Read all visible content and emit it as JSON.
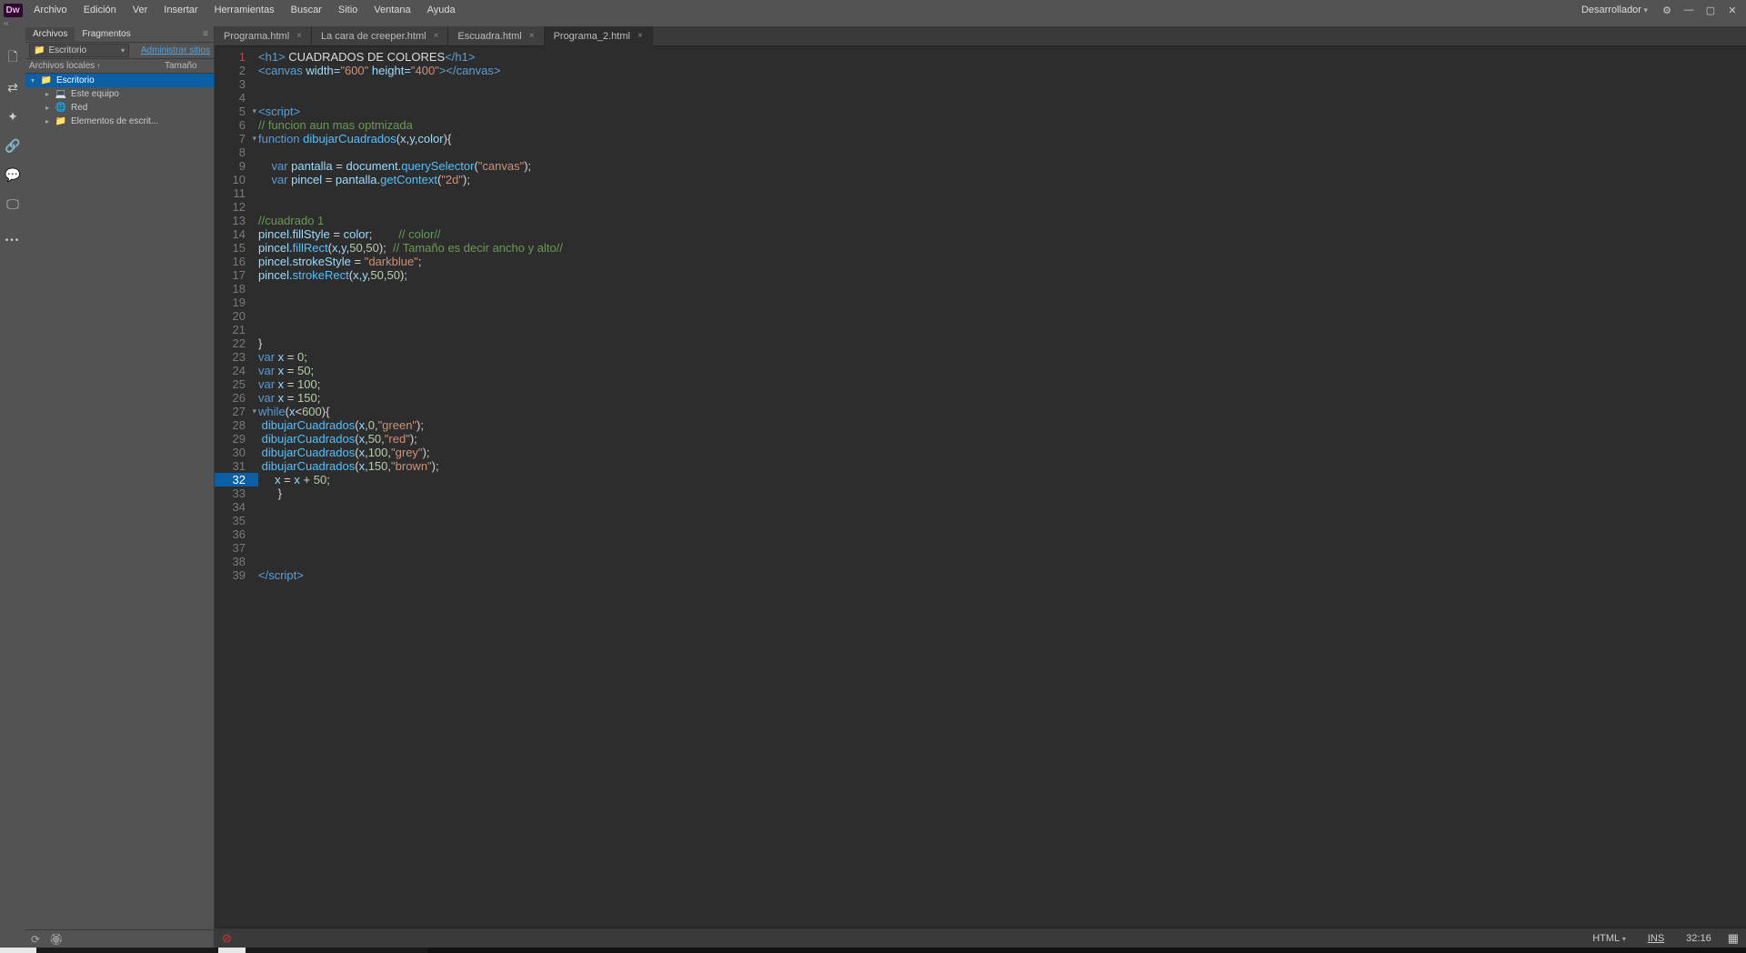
{
  "menubar": [
    "Archivo",
    "Edición",
    "Ver",
    "Insertar",
    "Herramientas",
    "Buscar",
    "Sitio",
    "Ventana",
    "Ayuda"
  ],
  "right_label": "Desarrollador",
  "panel": {
    "tabs": [
      "Archivos",
      "Fragmentos"
    ],
    "site": "Escritorio",
    "manage": "Administrar sitios",
    "col1": "Archivos locales",
    "col2": "Tamaño",
    "tree": [
      {
        "depth": 0,
        "exp": "▾",
        "icon": "📁",
        "label": "Escritorio",
        "selected": true,
        "color": "#4aa3df"
      },
      {
        "depth": 1,
        "exp": "▸",
        "icon": "💻",
        "label": "Este equipo",
        "color": "#5aa0d6"
      },
      {
        "depth": 1,
        "exp": "▸",
        "icon": "🌐",
        "label": "Red",
        "color": "#5aa0d6"
      },
      {
        "depth": 1,
        "exp": "▸",
        "icon": "📁",
        "label": "Elementos de escrit...",
        "color": "#d8a13a"
      }
    ]
  },
  "file_tabs": [
    {
      "label": "Programa.html",
      "active": false
    },
    {
      "label": "La cara de creeper.html",
      "active": false
    },
    {
      "label": "Escuadra.html",
      "active": false
    },
    {
      "label": "Programa_2.html",
      "active": true
    }
  ],
  "current_line": 32,
  "fold_lines": [
    5,
    7,
    27
  ],
  "code_lines": [
    [
      [
        "tag",
        "<h1>"
      ],
      [
        "txt",
        " CUADRADOS DE COLORES"
      ],
      [
        "tag",
        "</h1>"
      ]
    ],
    [
      [
        "tag",
        "<canvas "
      ],
      [
        "attr",
        "width="
      ],
      [
        "str",
        "\"600\""
      ],
      [
        "txt",
        " "
      ],
      [
        "attr",
        "height="
      ],
      [
        "str",
        "\"400\""
      ],
      [
        "tag",
        "></canvas>"
      ]
    ],
    [],
    [],
    [
      [
        "tag",
        "<script>"
      ]
    ],
    [
      [
        "cmt",
        "// funcion aun mas optmizada"
      ]
    ],
    [
      [
        "kw",
        "function "
      ],
      [
        "fn",
        "dibujarCuadrados"
      ],
      [
        "op",
        "("
      ],
      [
        "var",
        "x"
      ],
      [
        "op",
        ","
      ],
      [
        "var",
        "y"
      ],
      [
        "op",
        ","
      ],
      [
        "var",
        "color"
      ],
      [
        "op",
        ")"
      ],
      [
        "op",
        "{"
      ]
    ],
    [],
    [
      [
        "txt",
        "    "
      ],
      [
        "kw",
        "var "
      ],
      [
        "var",
        "pantalla"
      ],
      [
        "op",
        " = "
      ],
      [
        "var",
        "document"
      ],
      [
        "op",
        "."
      ],
      [
        "fn",
        "querySelector"
      ],
      [
        "op",
        "("
      ],
      [
        "str",
        "\"canvas\""
      ],
      [
        "op",
        ");"
      ]
    ],
    [
      [
        "txt",
        "    "
      ],
      [
        "kw",
        "var "
      ],
      [
        "var",
        "pincel"
      ],
      [
        "op",
        " = "
      ],
      [
        "var",
        "pantalla"
      ],
      [
        "op",
        "."
      ],
      [
        "fn",
        "getContext"
      ],
      [
        "op",
        "("
      ],
      [
        "str",
        "\"2d\""
      ],
      [
        "op",
        ");"
      ]
    ],
    [],
    [],
    [
      [
        "cmt",
        "//cuadrado 1"
      ]
    ],
    [
      [
        "var",
        "pincel"
      ],
      [
        "op",
        "."
      ],
      [
        "var",
        "fillStyle"
      ],
      [
        "op",
        " = "
      ],
      [
        "var",
        "color"
      ],
      [
        "op",
        ";        "
      ],
      [
        "cmt",
        "// color//"
      ]
    ],
    [
      [
        "var",
        "pincel"
      ],
      [
        "op",
        "."
      ],
      [
        "fn",
        "fillRect"
      ],
      [
        "op",
        "("
      ],
      [
        "var",
        "x"
      ],
      [
        "op",
        ","
      ],
      [
        "var",
        "y"
      ],
      [
        "op",
        ","
      ],
      [
        "num",
        "50"
      ],
      [
        "op",
        ","
      ],
      [
        "num",
        "50"
      ],
      [
        "op",
        ");  "
      ],
      [
        "cmt",
        "// Tamaño es decir ancho y alto//"
      ]
    ],
    [
      [
        "var",
        "pincel"
      ],
      [
        "op",
        "."
      ],
      [
        "var",
        "strokeStyle"
      ],
      [
        "op",
        " = "
      ],
      [
        "str",
        "\"darkblue\""
      ],
      [
        "op",
        ";"
      ]
    ],
    [
      [
        "var",
        "pincel"
      ],
      [
        "op",
        "."
      ],
      [
        "fn",
        "strokeRect"
      ],
      [
        "op",
        "("
      ],
      [
        "var",
        "x"
      ],
      [
        "op",
        ","
      ],
      [
        "var",
        "y"
      ],
      [
        "op",
        ","
      ],
      [
        "num",
        "50"
      ],
      [
        "op",
        ","
      ],
      [
        "num",
        "50"
      ],
      [
        "op",
        ");"
      ]
    ],
    [],
    [],
    [],
    [],
    [
      [
        "op",
        "}"
      ]
    ],
    [
      [
        "kw",
        "var "
      ],
      [
        "var",
        "x"
      ],
      [
        "op",
        " = "
      ],
      [
        "num",
        "0"
      ],
      [
        "op",
        ";"
      ]
    ],
    [
      [
        "kw",
        "var "
      ],
      [
        "var",
        "x"
      ],
      [
        "op",
        " = "
      ],
      [
        "num",
        "50"
      ],
      [
        "op",
        ";"
      ]
    ],
    [
      [
        "kw",
        "var "
      ],
      [
        "var",
        "x"
      ],
      [
        "op",
        " = "
      ],
      [
        "num",
        "100"
      ],
      [
        "op",
        ";"
      ]
    ],
    [
      [
        "kw",
        "var "
      ],
      [
        "var",
        "x"
      ],
      [
        "op",
        " = "
      ],
      [
        "num",
        "150"
      ],
      [
        "op",
        ";"
      ]
    ],
    [
      [
        "kw",
        "while"
      ],
      [
        "op",
        "("
      ],
      [
        "var",
        "x"
      ],
      [
        "op",
        "<"
      ],
      [
        "num",
        "600"
      ],
      [
        "op",
        ")"
      ],
      [
        "op",
        "{"
      ]
    ],
    [
      [
        "fn",
        " dibujarCuadrados"
      ],
      [
        "op",
        "("
      ],
      [
        "var",
        "x"
      ],
      [
        "op",
        ","
      ],
      [
        "num",
        "0"
      ],
      [
        "op",
        ","
      ],
      [
        "str",
        "\"green\""
      ],
      [
        "op",
        ");"
      ]
    ],
    [
      [
        "fn",
        " dibujarCuadrados"
      ],
      [
        "op",
        "("
      ],
      [
        "var",
        "x"
      ],
      [
        "op",
        ","
      ],
      [
        "num",
        "50"
      ],
      [
        "op",
        ","
      ],
      [
        "str",
        "\"red\""
      ],
      [
        "op",
        ");"
      ]
    ],
    [
      [
        "fn",
        " dibujarCuadrados"
      ],
      [
        "op",
        "("
      ],
      [
        "var",
        "x"
      ],
      [
        "op",
        ","
      ],
      [
        "num",
        "100"
      ],
      [
        "op",
        ","
      ],
      [
        "str",
        "\"grey\""
      ],
      [
        "op",
        ");"
      ]
    ],
    [
      [
        "fn",
        " dibujarCuadrados"
      ],
      [
        "op",
        "("
      ],
      [
        "var",
        "x"
      ],
      [
        "op",
        ","
      ],
      [
        "num",
        "150"
      ],
      [
        "op",
        ","
      ],
      [
        "str",
        "\"brown\""
      ],
      [
        "op",
        ");"
      ]
    ],
    [
      [
        "txt",
        "     "
      ],
      [
        "var",
        "x"
      ],
      [
        "op",
        " = "
      ],
      [
        "var",
        "x"
      ],
      [
        "op",
        " + "
      ],
      [
        "num",
        "50"
      ],
      [
        "op",
        ";"
      ]
    ],
    [
      [
        "txt",
        "      "
      ],
      [
        "op",
        "}"
      ]
    ],
    [],
    [],
    [],
    [],
    [],
    [
      [
        "tag",
        "</"
      ],
      [
        "tag",
        "script>"
      ]
    ]
  ],
  "status": {
    "lang": "HTML",
    "mode": "INS",
    "pos": "32:16"
  }
}
